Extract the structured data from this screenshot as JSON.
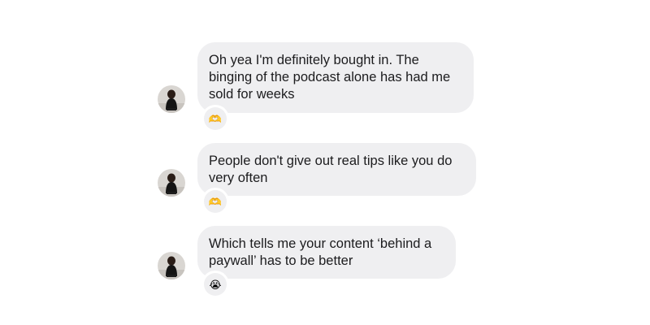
{
  "thread": {
    "messages": [
      {
        "text": "Oh yea I'm definitely bought in. The binging of the podcast alone has had me sold for weeks",
        "reaction": "🫶"
      },
      {
        "text": "People don't give out real tips like you do very often",
        "reaction": "🫶"
      },
      {
        "text": "Which tells me your content ‘behind a paywall’ has to be better",
        "reaction": "😭"
      }
    ]
  },
  "colors": {
    "bubble": "#efeff1",
    "text": "#1c1c1e",
    "background": "#ffffff"
  }
}
